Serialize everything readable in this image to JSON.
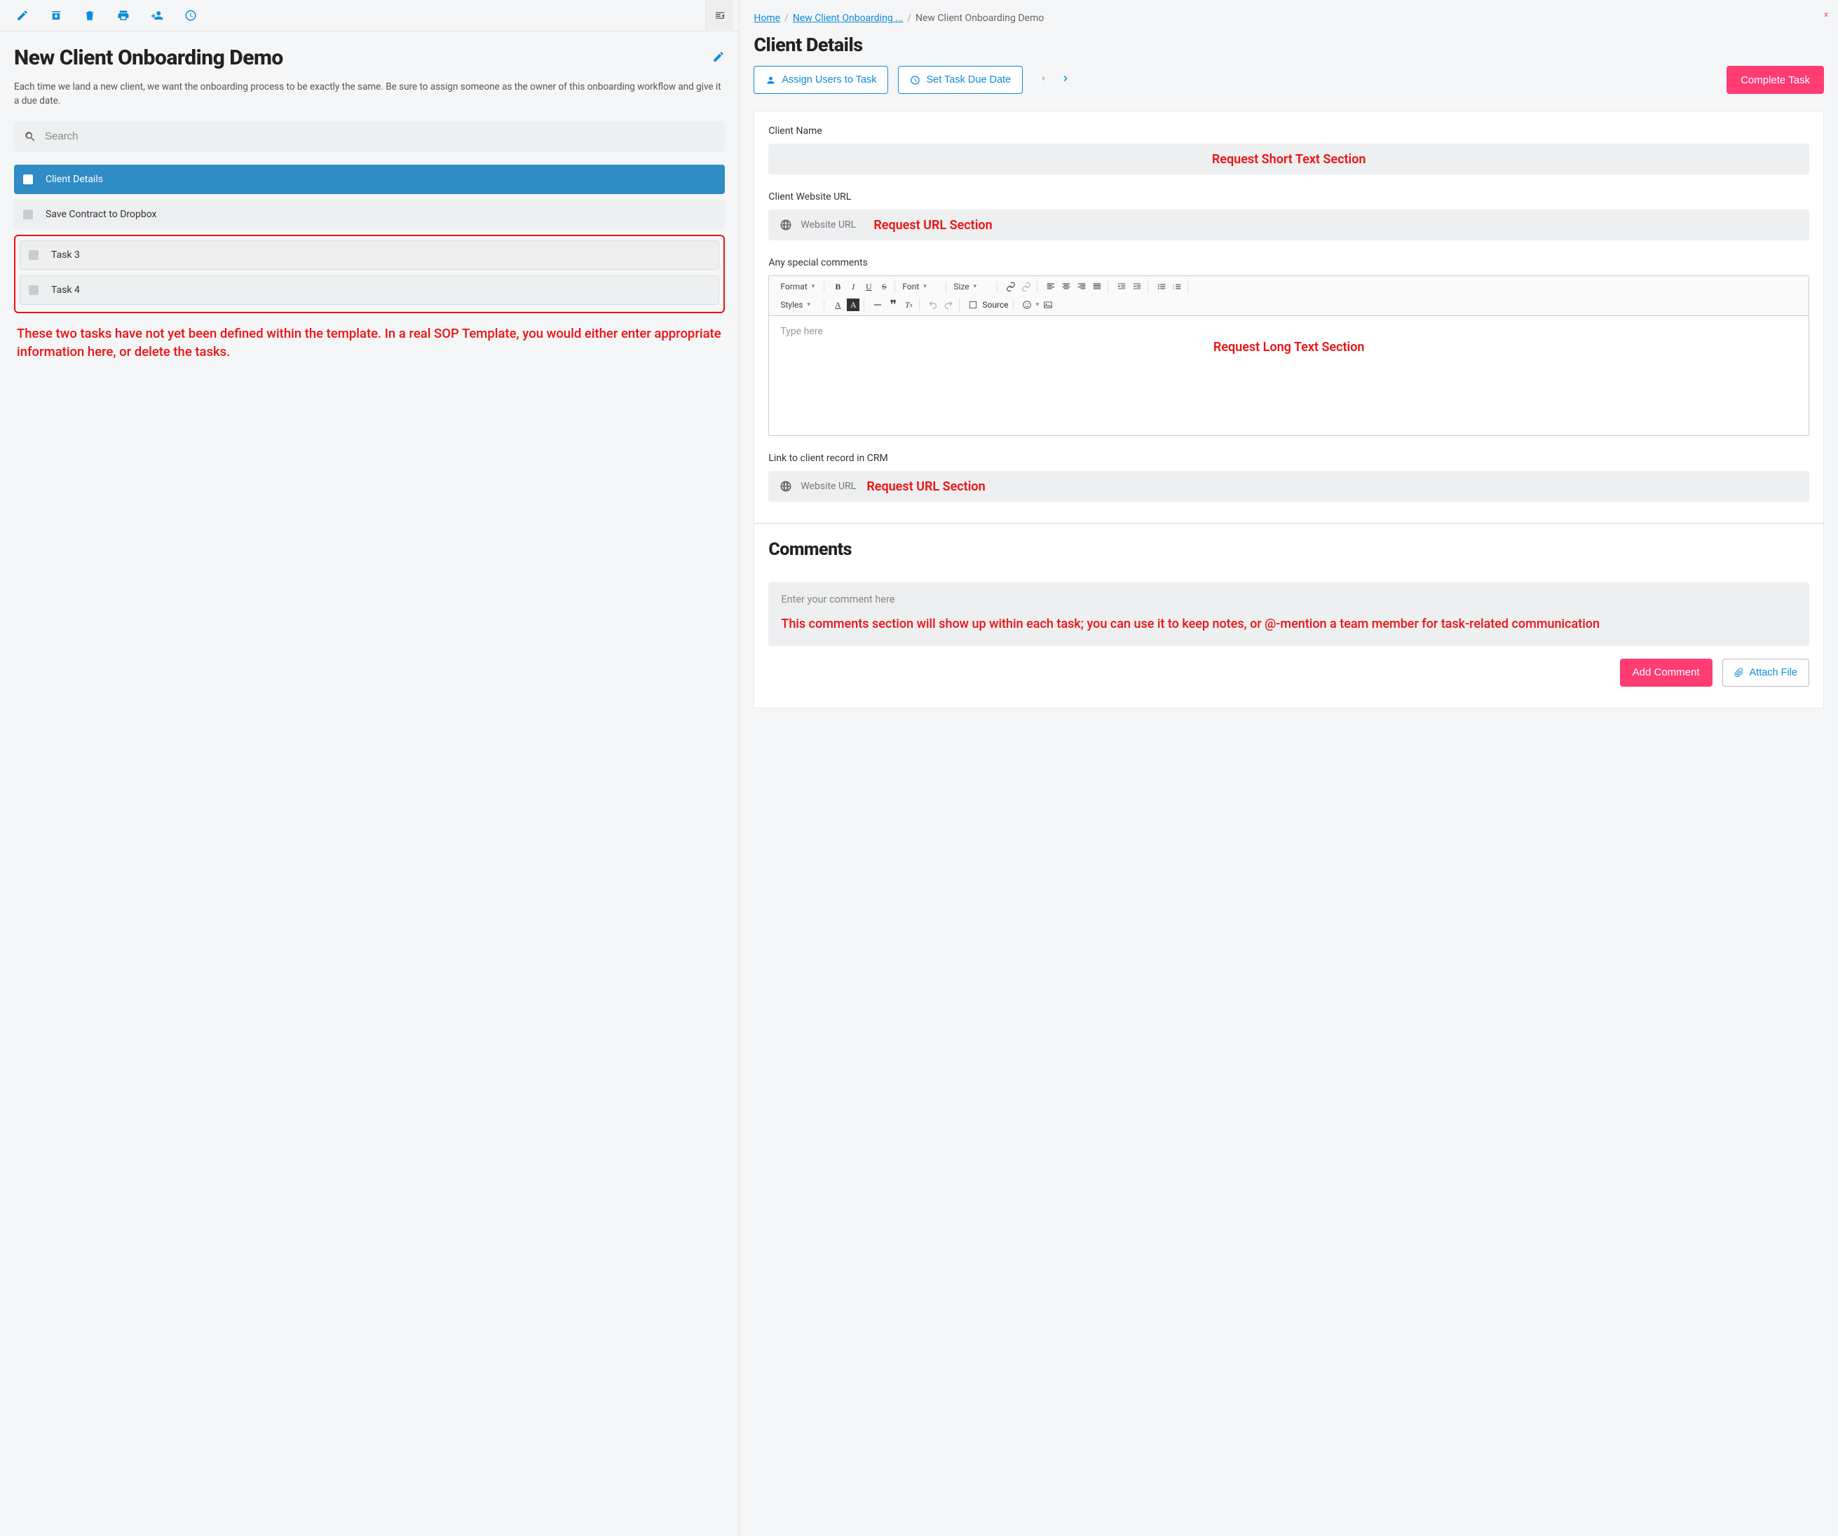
{
  "toolbar": {
    "icons": [
      "edit-icon",
      "archive-icon",
      "trash-icon",
      "print-icon",
      "person-add-icon",
      "clock-icon",
      "indent-left-icon"
    ]
  },
  "left": {
    "title": "New Client Onboarding Demo",
    "description": "Each time we land a new client, we want the onboarding process to be exactly the same. Be sure to assign someone as the owner of this onboarding workflow and give it a due date.",
    "search_placeholder": "Search",
    "tasks": [
      {
        "label": "Client Details",
        "active": true
      },
      {
        "label": "Save Contract to Dropbox",
        "active": false
      }
    ],
    "undefined_tasks": [
      {
        "label": "Task 3"
      },
      {
        "label": "Task 4"
      }
    ],
    "annotation": "These two tasks have not yet been defined within the template. In a real SOP Template, you would either enter appropriate information here, or delete the tasks."
  },
  "breadcrumb": {
    "home": "Home",
    "parent": "New Client Onboarding ...",
    "current": "New Client Onboarding Demo"
  },
  "page": {
    "title": "Client Details",
    "assign_button": "Assign Users to Task",
    "due_button": "Set Task Due Date",
    "complete_button": "Complete Task"
  },
  "fields": {
    "client_name_label": "Client Name",
    "client_name_overlay": "Request Short Text Section",
    "client_url_label": "Client Website URL",
    "url_placeholder": "Website URL",
    "url_overlay": "Request URL Section",
    "comments_label": "Any special comments",
    "rte": {
      "format": "Format",
      "font": "Font",
      "size": "Size",
      "styles": "Styles",
      "source": "Source",
      "placeholder": "Type here",
      "overlay": "Request Long Text Section"
    },
    "crm_label": "Link to client record in CRM",
    "crm_overlay": "Request URL Section"
  },
  "comments": {
    "heading": "Comments",
    "placeholder": "Enter your comment here",
    "overlay": "This comments section will show up within each task; you can use it to keep notes, or @-mention a team member for task-related communication",
    "add_button": "Add Comment",
    "attach_button": "Attach File"
  }
}
